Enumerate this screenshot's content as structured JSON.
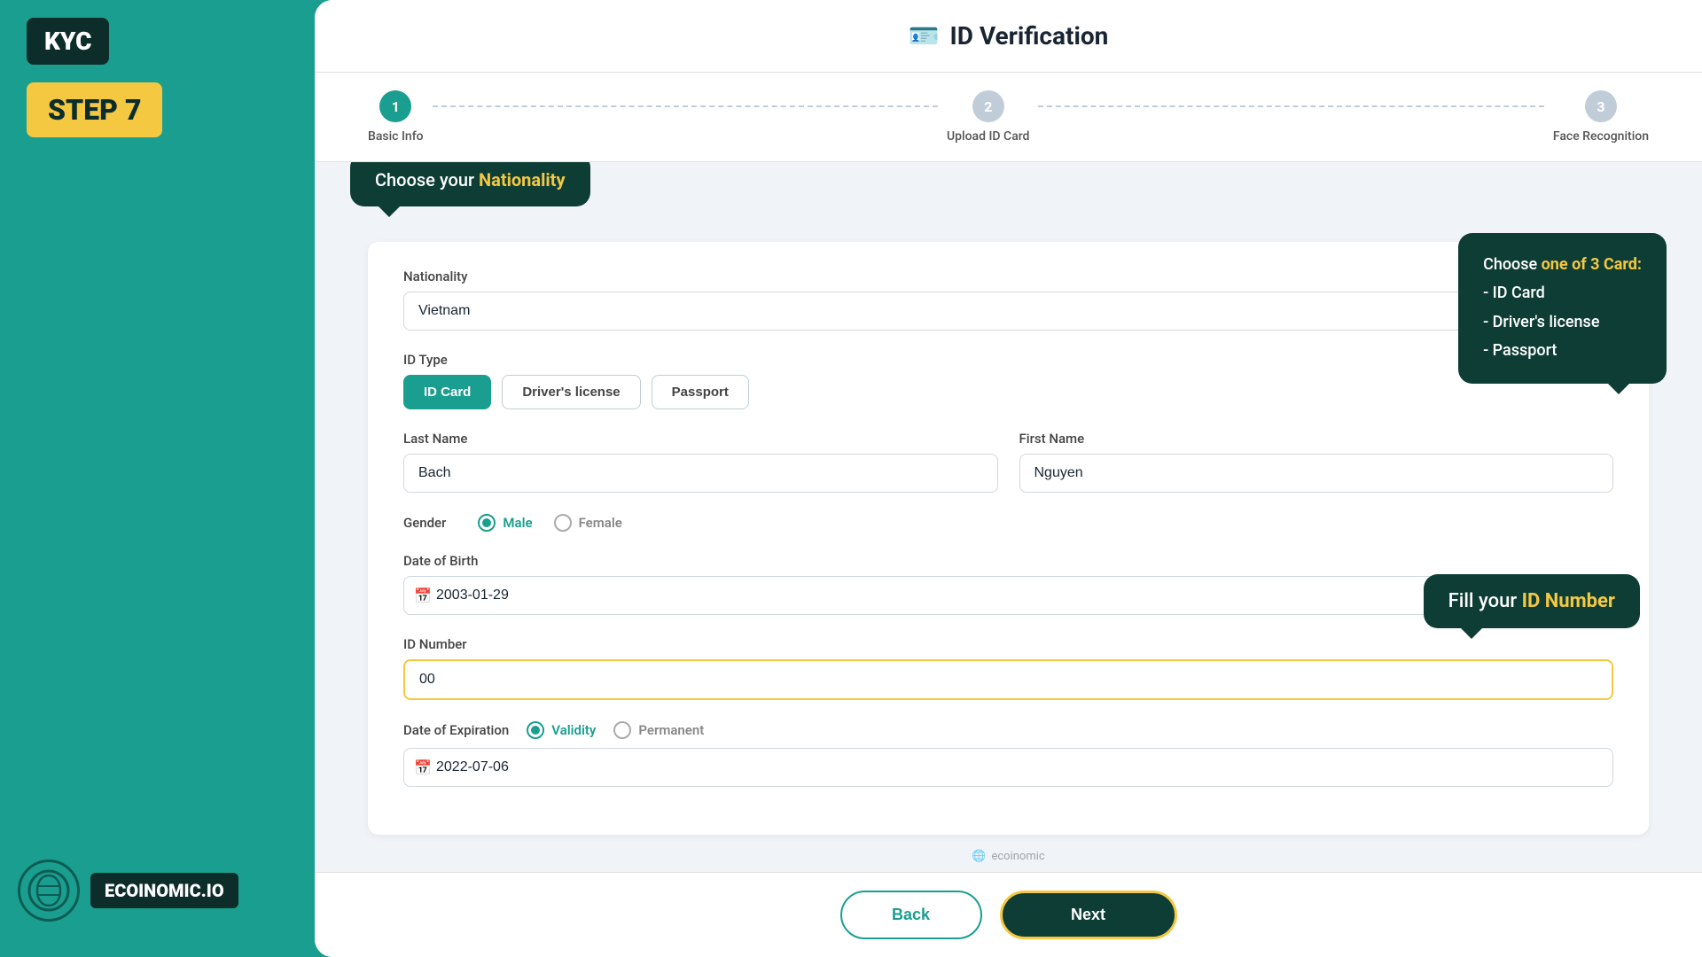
{
  "sidebar": {
    "kyc_label": "KYC",
    "step_label": "STEP 7"
  },
  "header": {
    "icon": "🪪",
    "title": "ID Verification"
  },
  "steps": [
    {
      "number": "1",
      "label": "Basic Info",
      "active": true
    },
    {
      "number": "2",
      "label": "Upload ID Card",
      "active": false
    },
    {
      "number": "3",
      "label": "Face Recognition",
      "active": false
    }
  ],
  "tooltips": {
    "nationality": "Choose your ",
    "nationality_highlight": "Nationality",
    "card_main": "Choose ",
    "card_highlight": "one of 3 Card:",
    "card_items": [
      "- ID Card",
      "- Driver's license",
      "- Passport"
    ],
    "idnumber_main": "Fill your ",
    "idnumber_highlight": "ID Number"
  },
  "form": {
    "nationality_label": "Nationality",
    "nationality_value": "Vietnam",
    "id_type_label": "ID Type",
    "id_types": [
      {
        "label": "ID Card",
        "selected": true
      },
      {
        "label": "Driver's license",
        "selected": false
      },
      {
        "label": "Passport",
        "selected": false
      }
    ],
    "last_name_label": "Last Name",
    "last_name_value": "Bach",
    "first_name_label": "First Name",
    "first_name_value": "Nguyen",
    "gender_label": "Gender",
    "gender_options": [
      {
        "label": "Male",
        "selected": true
      },
      {
        "label": "Female",
        "selected": false
      }
    ],
    "dob_label": "Date of Birth",
    "dob_value": "2003-01-29",
    "id_number_label": "ID Number",
    "id_number_value": "00",
    "expiry_label": "Date of Expiration",
    "expiry_options": [
      {
        "label": "Validity",
        "selected": true
      },
      {
        "label": "Permanent",
        "selected": false
      }
    ],
    "expiry_value": "2022-07-06"
  },
  "buttons": {
    "back": "Back",
    "next": "Next"
  },
  "logo": {
    "text": "ECOINOMIC.IO"
  }
}
